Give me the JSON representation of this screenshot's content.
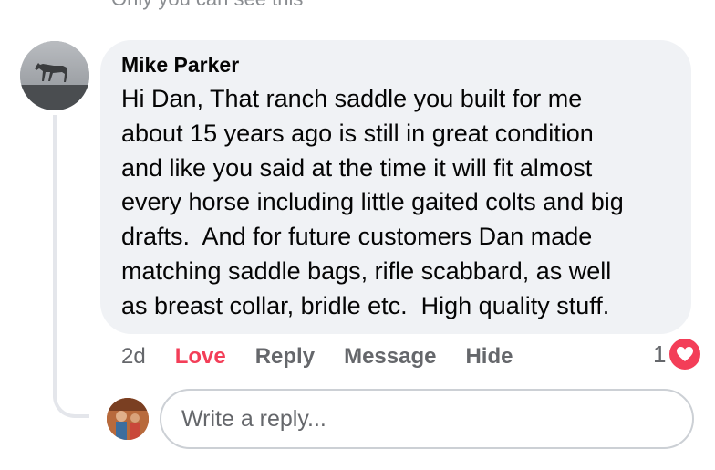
{
  "top_note": "Only you can see this",
  "comment": {
    "author": "Mike Parker",
    "text_lines": [
      "Hi Dan, That ranch saddle you built for me",
      "about 15 years ago is still in great condition",
      "and like you said at the time it will fit almost",
      "every horse including little gaited colts and big",
      "drafts.  And for future customers Dan made",
      "matching saddle bags, rifle scabbard, as well",
      "as breast collar, bridle etc.  High quality stuff."
    ],
    "time": "2d",
    "actions": {
      "love": "Love",
      "reply": "Reply",
      "message": "Message",
      "hide": "Hide"
    },
    "reaction_count": "1",
    "reaction_icon": "heart-icon"
  },
  "reply": {
    "placeholder": "Write a reply..."
  },
  "colors": {
    "bubble": "#f0f2f5",
    "love": "#f33e58",
    "muted": "#65676b"
  }
}
